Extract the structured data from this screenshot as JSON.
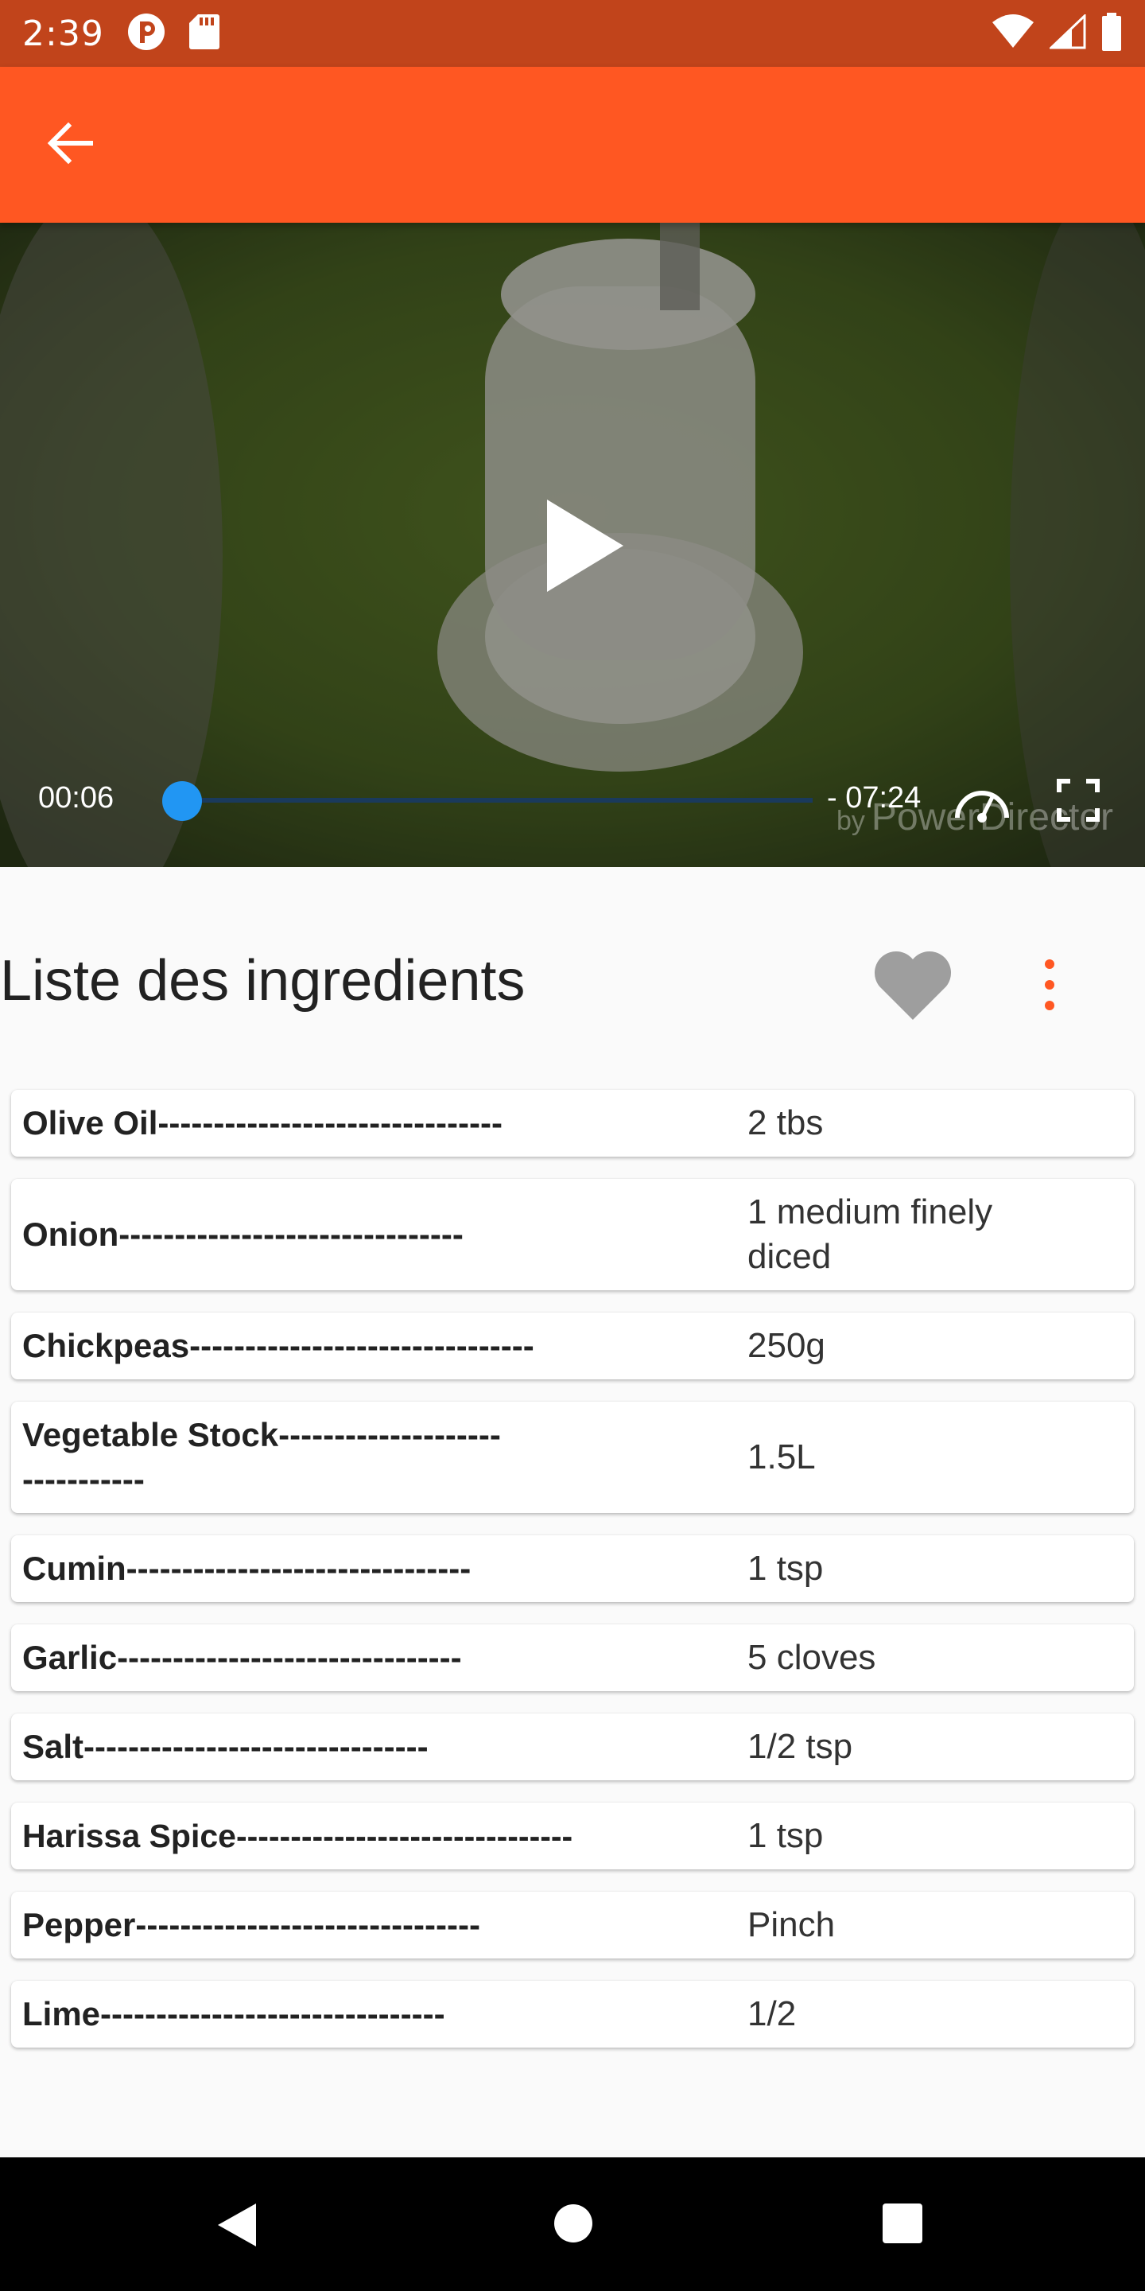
{
  "status_bar": {
    "time": "2:39"
  },
  "app_bar": {
    "back_icon": "arrow-back-icon",
    "color": "#ff5722"
  },
  "video": {
    "current_time": "00:06",
    "remaining_time": "- 07:24",
    "progress_fraction": 0.014,
    "watermark_by": "by",
    "watermark_brand": "PowerDirector",
    "seek_color": "#2196f3"
  },
  "ingredients_section": {
    "title": "Liste des ingredients",
    "favorite_icon": "heart-icon",
    "more_icon": "more-vert-icon",
    "accent": "#ff5722"
  },
  "ingredients": [
    {
      "name": "Olive Oil-------------------------------",
      "quantity": "2 tbs"
    },
    {
      "name": "Onion-------------------------------",
      "quantity": "1 medium finely diced"
    },
    {
      "name": "Chickpeas-------------------------------",
      "quantity": "250g"
    },
    {
      "name": "Vegetable Stock-------------------------------",
      "quantity": "1.5L"
    },
    {
      "name": "Cumin-------------------------------",
      "quantity": "1 tsp"
    },
    {
      "name": "Garlic-------------------------------",
      "quantity": "5 cloves"
    },
    {
      "name": "Salt-------------------------------",
      "quantity": "1/2 tsp"
    },
    {
      "name": "Harissa Spice-------------------------------",
      "quantity": "1 tsp"
    },
    {
      "name": "Pepper-------------------------------",
      "quantity": "Pinch"
    },
    {
      "name": "Lime-------------------------------",
      "quantity": "1/2"
    }
  ]
}
